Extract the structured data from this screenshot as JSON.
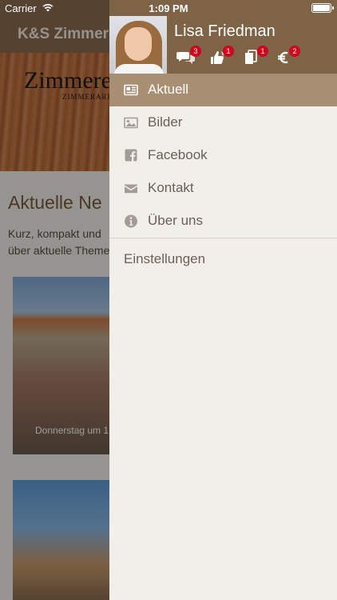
{
  "status_bar": {
    "carrier": "Carrier",
    "time": "1:09 PM"
  },
  "background": {
    "nav_title": "K&S Zimmere",
    "banner_logo": "Zimmere",
    "banner_sub": "ZIMMERARBE",
    "heading": "Aktuelle Ne",
    "intro_text_line1": "Kurz, kompakt und",
    "intro_text_line2": "über aktuelle Theme",
    "card1_caption": "Donnerstag um 1"
  },
  "drawer": {
    "user_name": "Lisa Friedman",
    "header_icons": [
      {
        "icon": "chat-bubbles-icon",
        "badge": "3"
      },
      {
        "icon": "thumbs-icon",
        "badge": "1"
      },
      {
        "icon": "documents-icon",
        "badge": "1"
      },
      {
        "icon": "euro-icon",
        "badge": "2"
      }
    ],
    "menu": [
      {
        "label": "Aktuell",
        "icon": "newspaper-icon",
        "active": true
      },
      {
        "label": "Bilder",
        "icon": "image-icon",
        "active": false
      },
      {
        "label": "Facebook",
        "icon": "facebook-icon",
        "active": false
      },
      {
        "label": "Kontakt",
        "icon": "envelope-icon",
        "active": false
      },
      {
        "label": "Über uns",
        "icon": "info-icon",
        "active": false
      }
    ],
    "settings_label": "Einstellungen"
  },
  "colors": {
    "header_bg": "#7e6346",
    "active_item_bg": "#a88e73",
    "drawer_bg": "#f2efeb",
    "badge": "#d0021b"
  }
}
